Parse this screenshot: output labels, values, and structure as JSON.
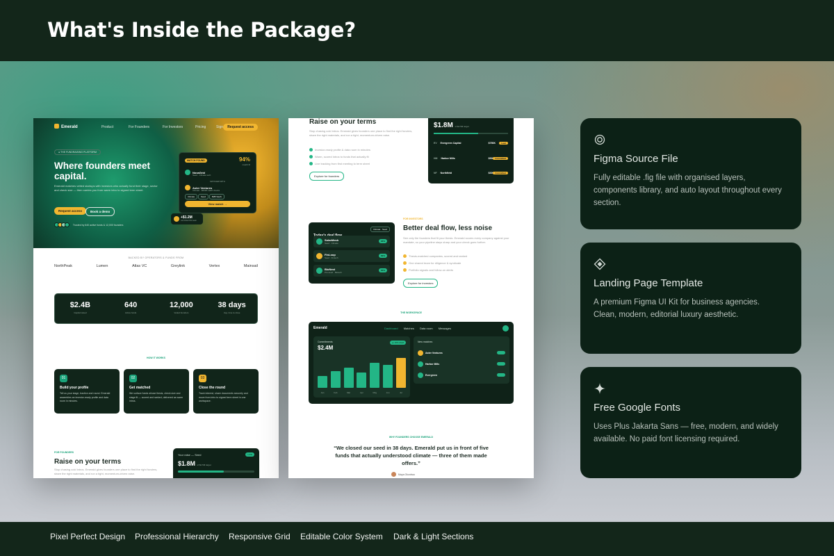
{
  "header": {
    "title": "What's Inside the Package?"
  },
  "landing": {
    "brand": "Emerald",
    "nav": [
      "Product",
      "For Founders",
      "For Investors",
      "Pricing",
      "Sign in"
    ],
    "nav_cta": "Request access",
    "pill": "● THE FUNDRAISING PLATFORM",
    "hero_title": "Where founders meet capital.",
    "hero_sub": "Emerald matches vetted startups with investors who actually fund their stage, sector and check size — then carries you from warm intro to signed term sheet.",
    "primary_cta": "Request access",
    "secondary_cta": "Book a demo",
    "trust": "Trusted by 640 active funds & 12,000 founders",
    "match_card": {
      "tag": "MATCH FOUND",
      "pct": "94%",
      "pct_label": "match fit",
      "company": "NovaGrid",
      "company_sub": "Seed · Climate tech",
      "matched_with": "MATCHED WITH",
      "investor": "Aster Ventures",
      "investor_sub": "Climate · $500K–$2M checks",
      "tags": [
        "Climate",
        "Seed",
        "B2B SaaS"
      ],
      "view": "View match →"
    },
    "raised_chip": {
      "amount": "+$1.2M",
      "label": "committed this week"
    },
    "backed_label": "BACKED BY OPERATORS & FUNDS FROM",
    "logos": [
      "NorthPeak",
      "Lumen",
      "Atlas VC",
      "Greylink",
      "Vertex",
      "Mainsail"
    ],
    "stats": [
      {
        "value": "$2.4B",
        "label": "Capital raised"
      },
      {
        "value": "640",
        "label": "Active funds"
      },
      {
        "value": "12,000",
        "label": "Vetted founders"
      },
      {
        "value": "38 days",
        "label": "Avg. time to close"
      }
    ],
    "how_label": "HOW IT WORKS",
    "steps": [
      {
        "num": "01",
        "title": "Build your profile",
        "text": "Tell us your stage, traction and round. Emerald assembles an investor-ready profile and data room in minutes."
      },
      {
        "num": "02",
        "title": "Get matched",
        "text": "We surface funds whose thesis, check size and stage fit — scored and ranked, delivered as warm intros."
      },
      {
        "num": "03",
        "title": "Close the round",
        "text": "Track interest, share documents securely and move from intro to signed term sheet in one workspace."
      }
    ],
    "founders_label": "FOR FOUNDERS",
    "raise_title": "Raise on your terms",
    "raise_text": "Stop chasing cold intros. Emerald gives founders one place to find the right funders, share the right materials, and run a tight, momentum-driven raise.",
    "mini_card": {
      "title": "Your raise — Seed",
      "tag": "LIVE",
      "amount": "$1.8M",
      "amount_sub": "of $2.5M target"
    }
  },
  "landing2": {
    "raise_title": "Raise on your terms",
    "raise_text": "Stop chasing cold intros. Emerald gives founders one place to find the right funders, share the right materials, and run a tight, momentum-driven raise.",
    "checks": [
      "Investor-ready profile & data room in minutes",
      "Warm, scored intros to funds that actually fit",
      "Live tracking from first meeting to term sheet"
    ],
    "founders_btn": "Explore for founders",
    "summary": {
      "amount": "$1.8M",
      "amount_sub": "of $2.5M target",
      "rows": [
        {
          "initials": "EV",
          "name": "Evergreen Capital",
          "value": "$750K",
          "status": "Lead"
        },
        {
          "initials": "HM",
          "name": "Harbor Mills",
          "value": "$500K",
          "status": "Committed"
        },
        {
          "initials": "NF",
          "name": "Northfield",
          "value": "$300K",
          "status": "Committed"
        }
      ]
    },
    "investors_label": "FOR INVESTORS",
    "deal_title": "Better deal flow, less noise",
    "deal_text": "See only the founders that fit your thesis. Emerald scores every company against your mandate, so your pipeline stays sharp and your check goes further.",
    "deal_checks": [
      "Thesis-matched companies, scored and ranked",
      "One shared team for diligence & syndicate",
      "Portfolio signals and follow-on alerts"
    ],
    "investors_btn": "Explore for investors",
    "deal_card": {
      "title": "Today's deal flow",
      "filter": "Climate · Seed",
      "rows": [
        {
          "initials": "SM",
          "name": "SolarMesh",
          "sub": "Seed · Climate",
          "score": "96%"
        },
        {
          "initials": "FL",
          "name": "FinLoop",
          "sub": "Seed · Fintech",
          "score": "89%"
        },
        {
          "initials": "BN",
          "name": "BioNest",
          "sub": "Pre-seed · Biotech",
          "score": "83%"
        }
      ]
    },
    "workspace_label": "THE WORKSPACE",
    "dash": {
      "brand": "Emerald",
      "tabs": [
        "Dashboard",
        "Matches",
        "Data room",
        "Messages"
      ],
      "commit_label": "Commitments",
      "commit_value": "$2.4M",
      "commit_up": "▲ 18% MoM",
      "bars": [
        0.36,
        0.5,
        0.6,
        0.46,
        0.76,
        0.68,
        0.9
      ],
      "months": [
        "Jan",
        "Feb",
        "Mar",
        "Apr",
        "May",
        "Jun",
        "Jul"
      ],
      "matches_label": "New matches",
      "matches": [
        "Aster Ventures",
        "Harbor Mills",
        "Evergreen"
      ]
    },
    "why_label": "WHY FOUNDERS CHOOSE EMERALD",
    "quote": "“We closed our seed in 38 days. Emerald put us in front of five funds that actually understood climate — three of them made offers.”",
    "quote_author": "Maya Okonkwo"
  },
  "features": [
    {
      "icon": "target-icon",
      "title": "Figma Source File",
      "text": "Fully editable .fig file with organised layers, components library, and auto layout throughout every section."
    },
    {
      "icon": "diamond-icon",
      "title": "Landing Page Template",
      "text": "A premium Figma UI Kit for business agencies. Clean, modern, editorial luxury aesthetic."
    },
    {
      "icon": "sparkle-icon",
      "title": "Free Google Fonts",
      "text": "Uses Plus Jakarta Sans — free, modern, and widely available. No paid font licensing required."
    }
  ],
  "footer": [
    "Pixel Perfect Design",
    "Professional Hierarchy",
    "Responsive Grid",
    "Editable Color System",
    "Dark & Light Sections"
  ]
}
